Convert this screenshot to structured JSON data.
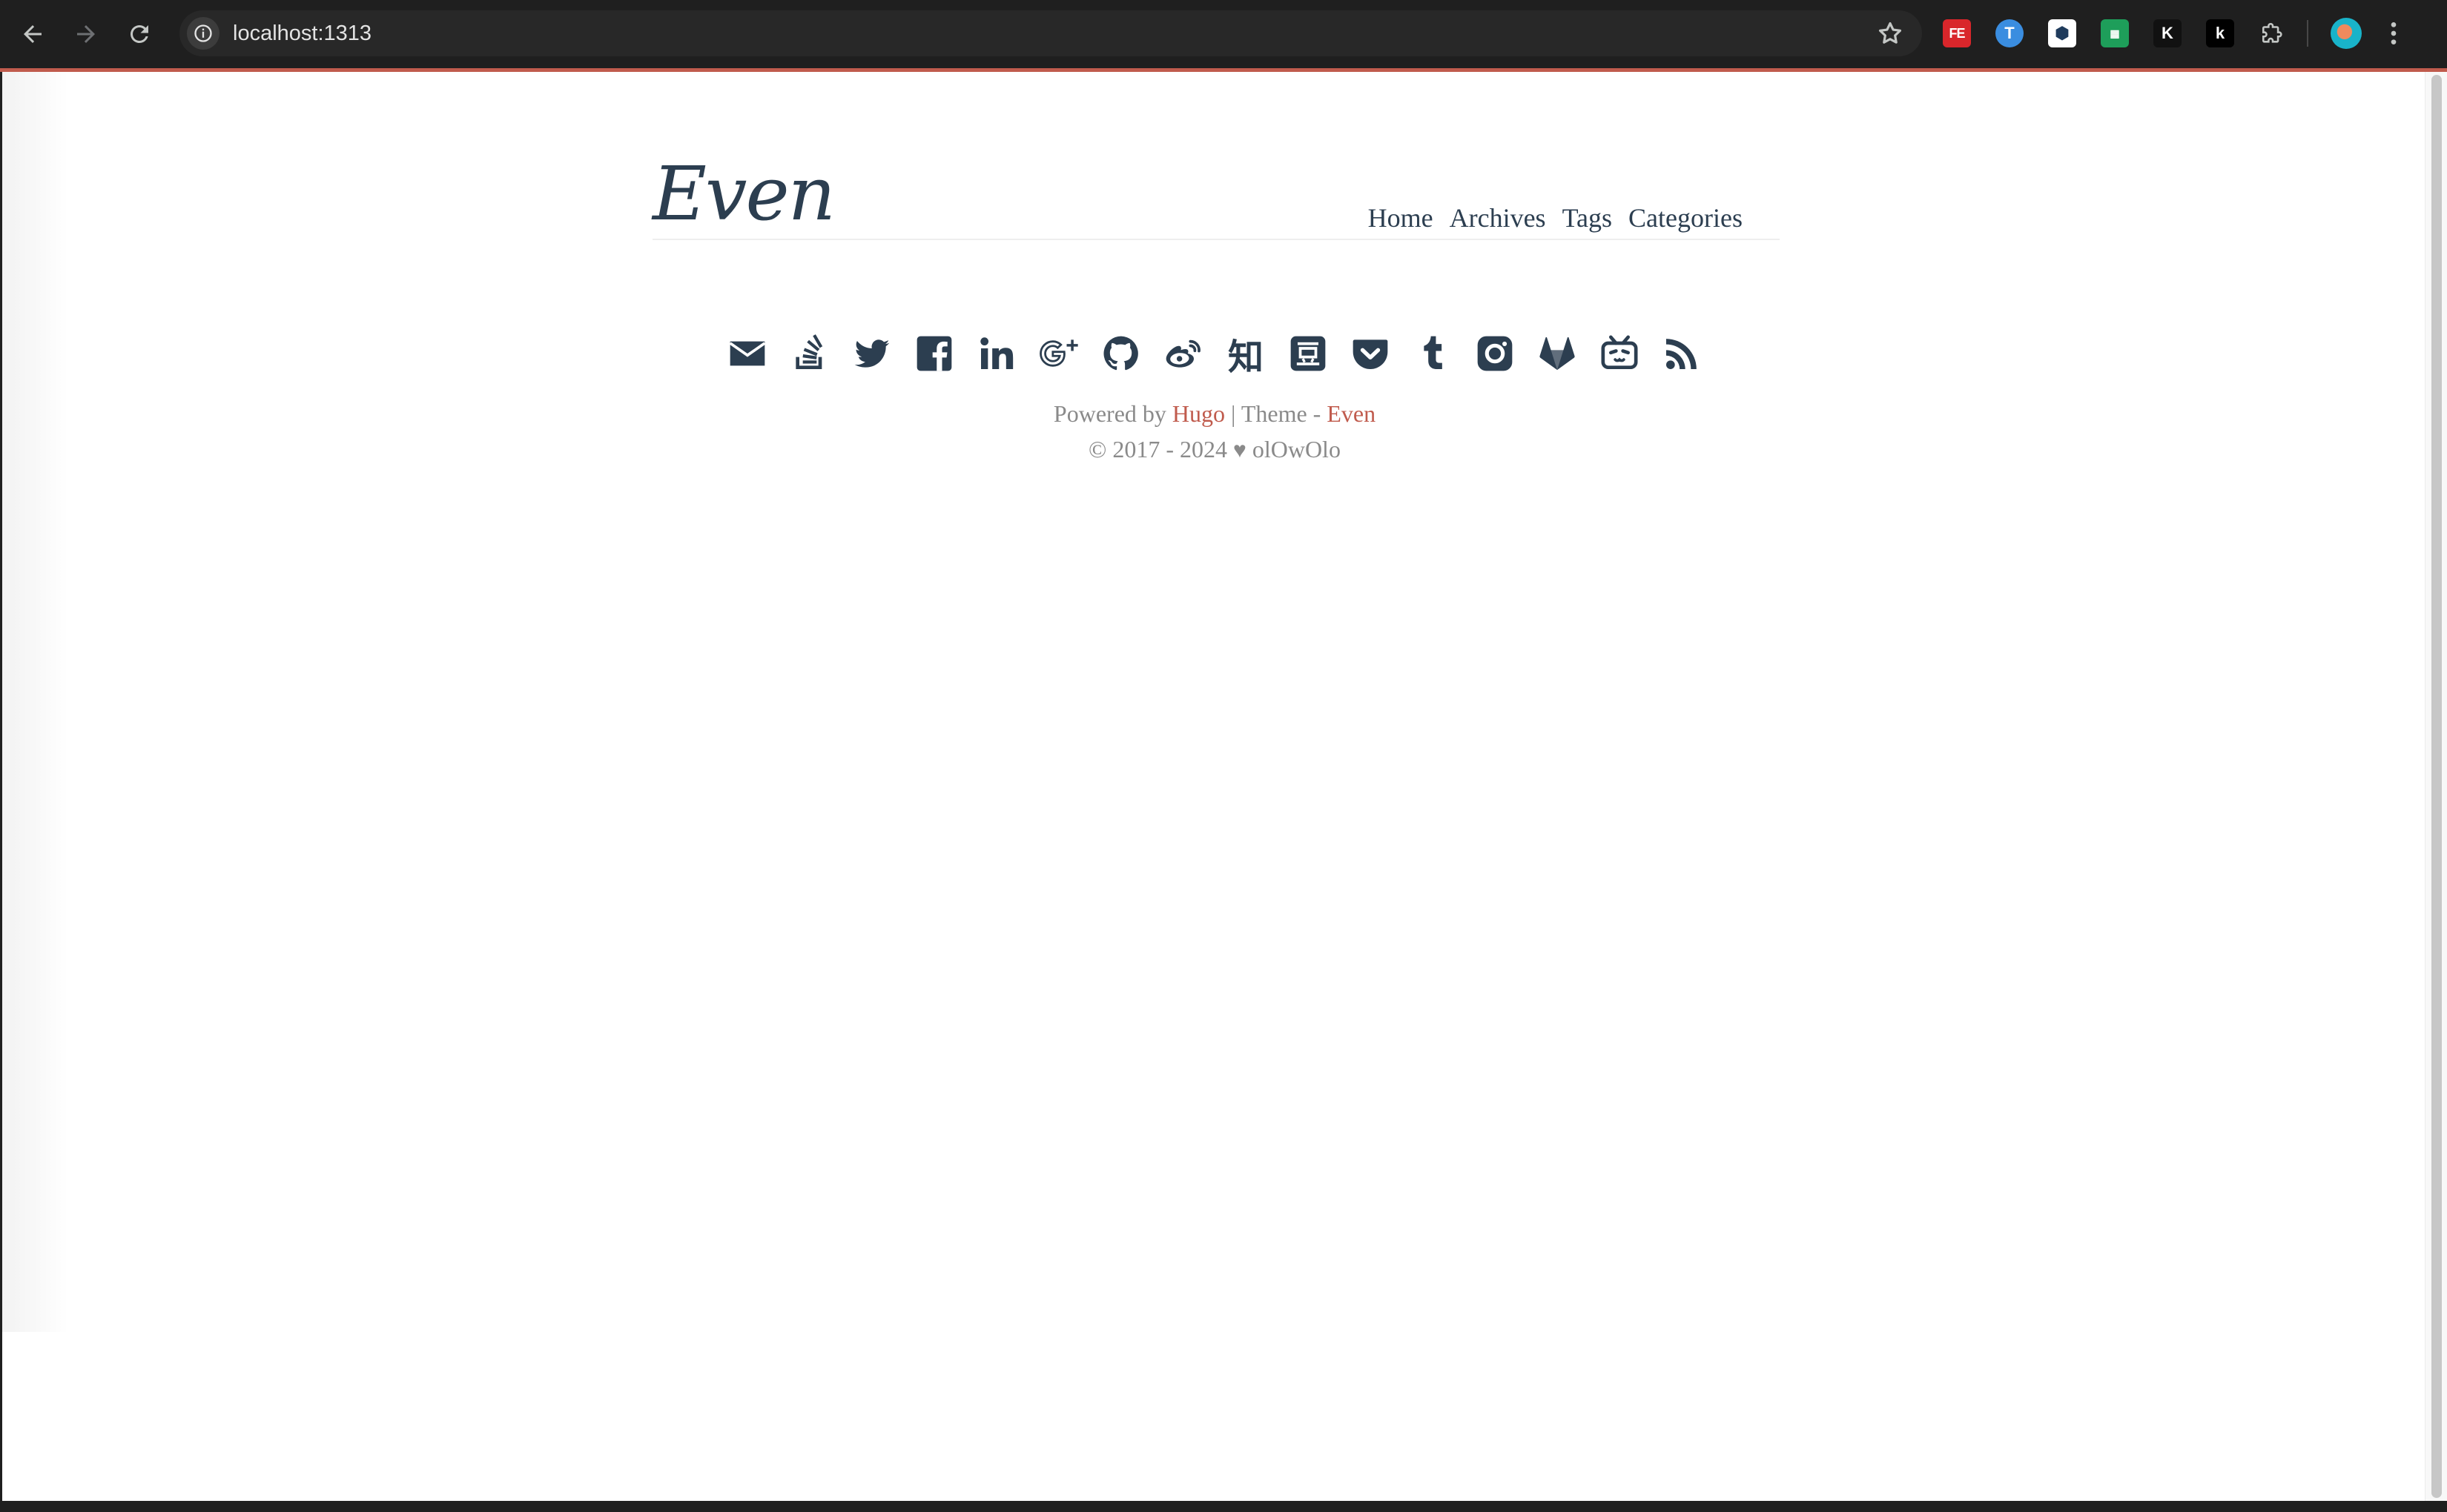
{
  "browser": {
    "url": "localhost:1313",
    "extensions": [
      "FE",
      "T",
      "⬢",
      "▦",
      "K",
      "k"
    ]
  },
  "site": {
    "logo": "Even",
    "nav": [
      "Home",
      "Archives",
      "Tags",
      "Categories"
    ]
  },
  "social_icons": [
    "email-icon",
    "stack-overflow-icon",
    "twitter-icon",
    "facebook-icon",
    "linkedin-icon",
    "google-plus-icon",
    "github-icon",
    "weibo-icon",
    "zhihu-icon",
    "douban-icon",
    "pocket-icon",
    "tumblr-icon",
    "instagram-icon",
    "gitlab-icon",
    "bilibili-icon",
    "rss-icon"
  ],
  "zhihu_glyph": "知",
  "footer": {
    "powered_by": "Powered by",
    "hugo": "Hugo",
    "separator": "|",
    "theme_label": "Theme -",
    "theme_name": "Even",
    "copyright_years": "© 2017 - 2024",
    "author": "olOwOlo"
  },
  "colors": {
    "accent": "#c05b4d",
    "text": "#2c3e50",
    "muted": "#8a8a8a"
  }
}
